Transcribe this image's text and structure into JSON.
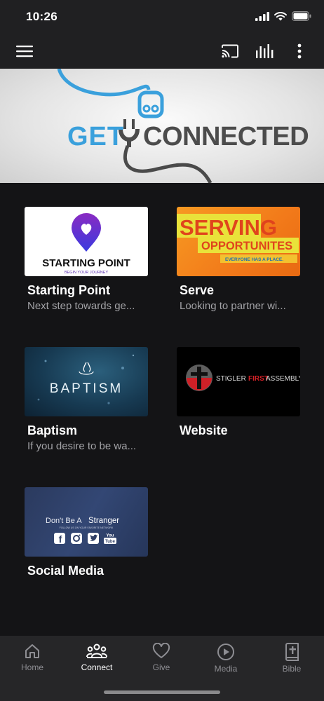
{
  "status": {
    "time": "10:26"
  },
  "header": {
    "menu_icon": "hamburger-icon",
    "cast_icon": "cast-icon",
    "audio_icon": "equalizer-icon",
    "more_icon": "more-vertical-icon"
  },
  "banner": {
    "word1": "GET",
    "word2": "CONNECTED"
  },
  "cards": [
    {
      "title": "Starting Point",
      "subtitle": "Next step towards ge...",
      "thumb_text": "STARTING POINT",
      "thumb_sub": "BEGIN YOUR JOURNEY"
    },
    {
      "title": "Serve",
      "subtitle": "Looking to partner wi...",
      "thumb_text": "SERVING",
      "thumb_text2": "OPPORTUNITES",
      "thumb_sub": "EVERYONE HAS A PLACE."
    },
    {
      "title": "Baptism",
      "subtitle": "If you desire to be wa...",
      "thumb_text": "BAPTISM"
    },
    {
      "title": "Website",
      "subtitle": "",
      "thumb_text": "STIGLER",
      "thumb_text2": "FIRST",
      "thumb_text3": "ASSEMBLY"
    },
    {
      "title": "Social Media",
      "subtitle": "",
      "thumb_text": "Don't Be A",
      "thumb_text2": "Stranger",
      "thumb_sub": "FOLLOW US ON YOUR FAVORITE NETWORK",
      "thumb_youtube": "You Tube"
    }
  ],
  "tabs": [
    {
      "label": "Home",
      "icon": "home-icon",
      "active": false
    },
    {
      "label": "Connect",
      "icon": "people-icon",
      "active": true
    },
    {
      "label": "Give",
      "icon": "heart-icon",
      "active": false
    },
    {
      "label": "Media",
      "icon": "play-circle-icon",
      "active": false
    },
    {
      "label": "Bible",
      "icon": "bible-icon",
      "active": false
    }
  ],
  "colors": {
    "background": "#141416",
    "header": "#202022",
    "tab_bar": "#262628",
    "subtitle": "#a2a2a6",
    "banner_blue": "#3aa0dc"
  }
}
